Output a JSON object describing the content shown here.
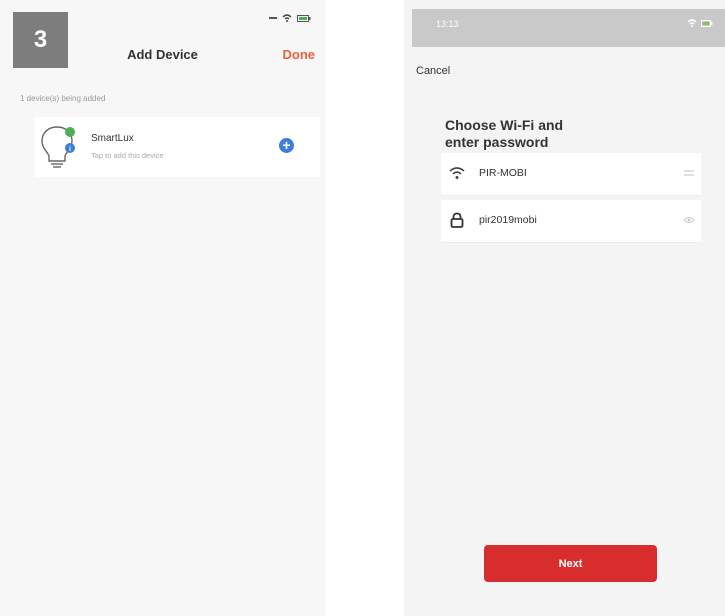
{
  "left_screen": {
    "step_number": "3",
    "title": "Add Device",
    "done_label": "Done",
    "section_label": "1 device(s) being added",
    "device": {
      "name": "SmartLux",
      "subtitle": "Tap to add this device",
      "icon": "lightbulb-icon",
      "add_icon": "+"
    }
  },
  "right_screen": {
    "status_time": "13:13",
    "cancel_label": "Cancel",
    "title_line1": "Choose Wi-Fi and",
    "title_line2": "enter password",
    "ssid": {
      "icon": "wifi-icon",
      "value": "PIR-MOBI"
    },
    "password": {
      "icon": "lock-icon",
      "value": "pir2019mobi"
    },
    "next_label": "Next"
  },
  "colors": {
    "accent_orange": "#e8613c",
    "add_blue": "#3b7fd9",
    "next_red": "#d82d2d"
  }
}
